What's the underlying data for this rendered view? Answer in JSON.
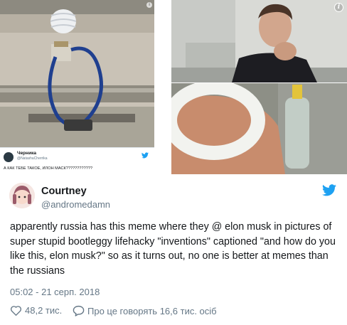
{
  "left_panel": {
    "embedded_tweet": {
      "name": "Черника",
      "handle": "@NatashaCherrika",
      "text": "А КАК ТЕБЕ ТАКОЕ, ИЛОН МАСК????????????"
    }
  },
  "tweet": {
    "name": "Courtney",
    "handle": "@andromedamn",
    "text": "apparently russia has this meme where they @ elon musk in pictures of super stupid bootleggy lifehacky \"inventions\" captioned \"and how do you like this, elon musk?\" so as it turns out, no one is better at memes than the russians",
    "timestamp": "05:02 - 21 серп. 2018",
    "likes": "48,2 тис.",
    "replies_label": "Про це говорять 16,6 тис. осіб"
  },
  "colors": {
    "twitter_blue": "#1da1f2",
    "text": "#14171a",
    "muted": "#657786"
  },
  "icons": {
    "like": "heart-icon",
    "reply": "speech-bubble-icon",
    "brand": "twitter-bird-icon",
    "info": "info-icon"
  }
}
